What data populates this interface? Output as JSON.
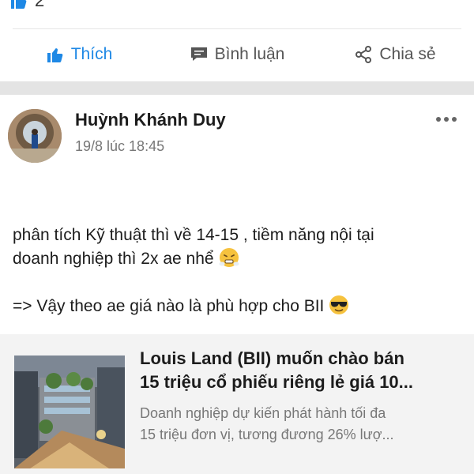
{
  "previous_post": {
    "reaction_count": "2"
  },
  "actions": {
    "like_label": "Thích",
    "comment_label": "Bình luận",
    "share_label": "Chia sẻ"
  },
  "post": {
    "author": "Huỳnh Khánh Duy",
    "timestamp": "19/8 lúc 18:45",
    "text_line1": "phân tích Kỹ thuật thì về 14-15 , tiềm năng nội tại",
    "text_line2": "doanh nghiệp thì 2x ae nhể",
    "text_line3": "=> Vậy theo ae giá nào là phù hợp cho BII",
    "link": {
      "title_line1": "Louis Land (BII) muốn chào bán",
      "title_line2": "15 triệu cổ phiếu riêng lẻ giá 10...",
      "desc_line1": "Doanh nghiệp dự kiến phát hành tối đa",
      "desc_line2": "15 triệu đơn vị, tương đương 26% lượ..."
    }
  },
  "icons": {
    "like": "thumbs-up-icon",
    "comment": "comment-icon",
    "share": "share-icon",
    "more": "more-horizontal-icon",
    "emoji1": "steam-from-nose-emoji",
    "emoji2": "sunglasses-emoji"
  },
  "colors": {
    "accent": "#1e88e5",
    "separator": "#e4e4e4",
    "link_card_bg": "#f3f3f3",
    "muted_text": "#777777"
  }
}
